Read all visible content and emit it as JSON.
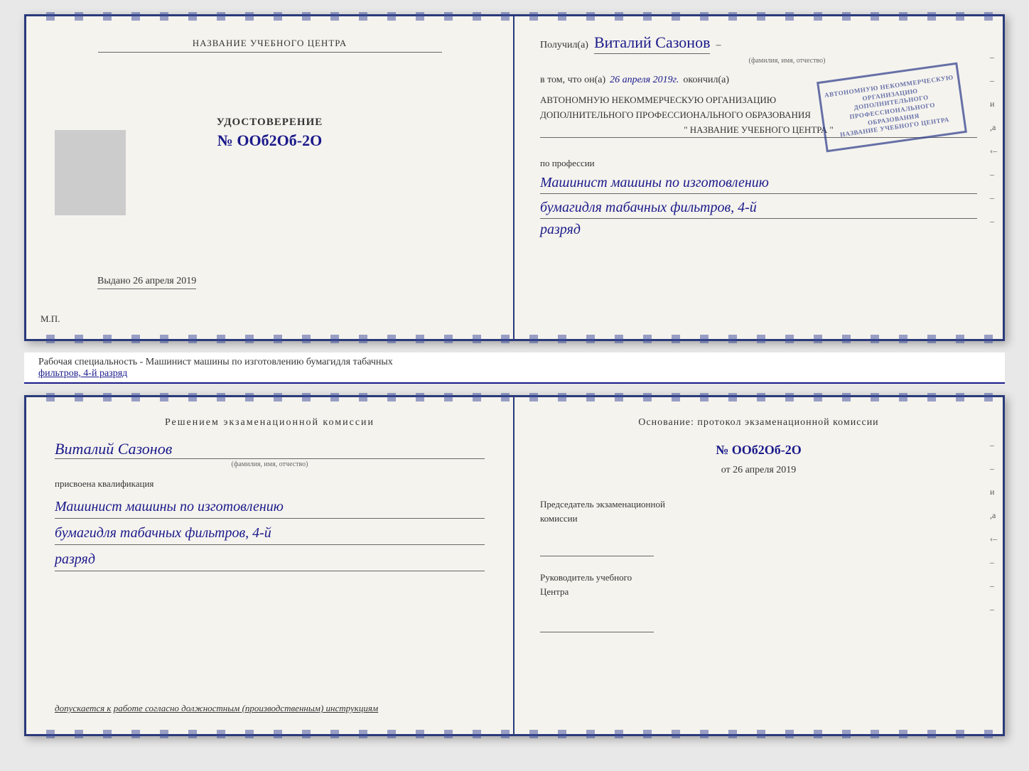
{
  "topDoc": {
    "leftPage": {
      "training_center_label": "НАЗВАНИЕ УЧЕБНОГО ЦЕНТРА",
      "udostoverenie_title": "УДОСТОВЕРЕНИЕ",
      "number": "№ ООб2Об-2О",
      "vydano_label": "Выдано",
      "vydano_date": "26 апреля 2019",
      "mp_label": "М.П."
    },
    "rightPage": {
      "recipient_prefix": "Получил(а)",
      "recipient_name": "Виталий Сазонов",
      "recipient_dash": "–",
      "fio_label": "(фамилия, имя, отчество)",
      "vtom_prefix": "в том, что он(а)",
      "vtom_date": "26 апреля 2019г.",
      "okonchil": "окончил(а)",
      "org_line1": "АВТОНОМНУЮ НЕКОММЕРЧЕСКУЮ ОРГАНИЗАЦИЮ",
      "org_line2": "ДОПОЛНИТЕЛЬНОГО ПРОФЕССИОНАЛЬНОГО ОБРАЗОВАНИЯ",
      "org_name_placeholder": "\" НАЗВАНИЕ УЧЕБНОГО ЦЕНТРА \"",
      "po_professii": "по профессии",
      "profession_line1": "Машинист машины по изготовлению",
      "profession_line2": "бумагидля табачных фильтров, 4-й",
      "razryad": "разряд",
      "stamp_text": "АВТОНОМНУЮ НЕКОММЕРЧЕСКУЮ\nОРГАНИЗАЦИЮ\nДОПОЛНИТЕЛЬНОГО\nПРОФЕССИОНАЛЬНОГО\nОБРАЗОВАНИЯ\nНАЗВАНИЕ УЧЕБНОГО ЦЕНТРА"
    }
  },
  "caption": {
    "line1": "Рабочая специальность - Машинист машины по изготовлению бумагидля табачных",
    "line2": "фильтров, 4-й разряд"
  },
  "bottomDoc": {
    "leftPage": {
      "komissia_title": "Решением  экзаменационной  комиссии",
      "name_hw": "Виталий Сазонов",
      "fio_label": "(фамилия, имя, отчество)",
      "prisvoyena": "присвоена квалификация",
      "profession_line1": "Машинист машины по изготовлению",
      "profession_line2": "бумагидля табачных фильтров, 4-й",
      "razryad": "разряд",
      "dopuskaetsya_prefix": "допускается к",
      "dopuskaetsya_text": "работе согласно должностным (производственным) инструкциям"
    },
    "rightPage": {
      "osnovanie_title": "Основание: протокол  экзаменационной  комиссии",
      "protocol_number": "№  ООб2Об-2О",
      "ot_label": "от",
      "ot_date": "26 апреля 2019",
      "predsedatel_label": "Председатель экзаменационной\nкомиссии",
      "rukovoditel_label": "Руководитель учебного\nЦентра"
    }
  },
  "sideMarks": {
    "marks": [
      "–",
      "–",
      "и",
      ",а",
      "‹–",
      "–",
      "–",
      "–"
    ]
  }
}
